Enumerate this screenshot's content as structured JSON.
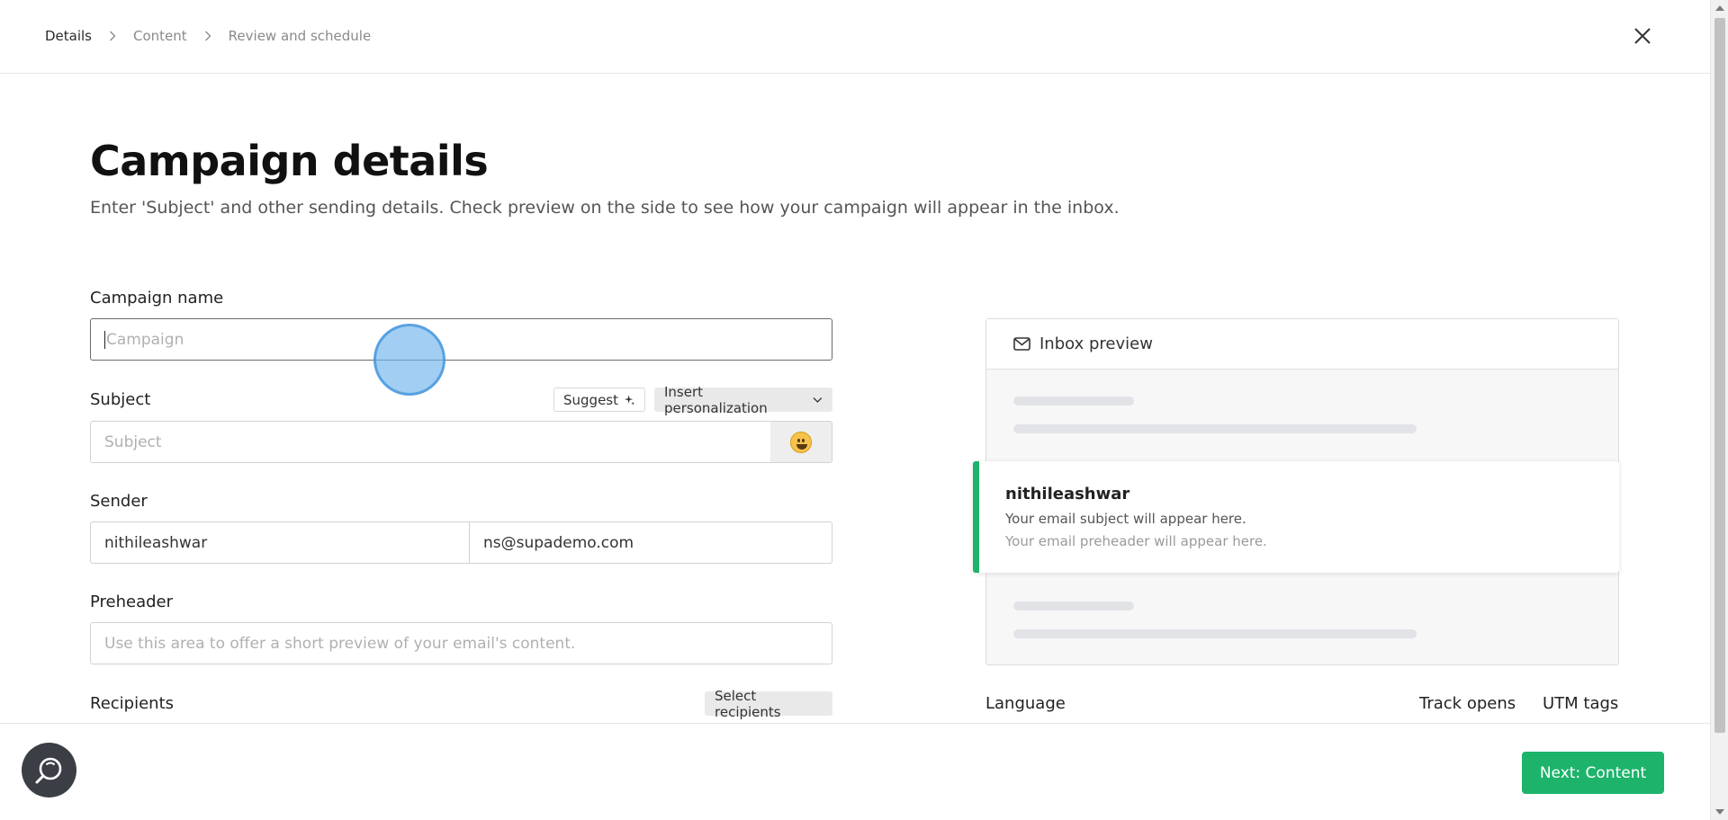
{
  "breadcrumb": {
    "items": [
      {
        "label": "Details",
        "active": true
      },
      {
        "label": "Content",
        "active": false
      },
      {
        "label": "Review and schedule",
        "active": false
      }
    ]
  },
  "header": {
    "title": "Campaign details",
    "subtitle": "Enter 'Subject' and other sending details. Check preview on the side to see how your campaign will appear in the inbox."
  },
  "form": {
    "campaign_name": {
      "label": "Campaign name",
      "placeholder": "Campaign",
      "value": ""
    },
    "subject": {
      "label": "Subject",
      "placeholder": "Subject",
      "value": "",
      "suggest_label": "Suggest",
      "personalization_label": "Insert personalization"
    },
    "sender": {
      "label": "Sender",
      "name": "nithileashwar",
      "email": "ns@supademo.com"
    },
    "preheader": {
      "label": "Preheader",
      "placeholder": "Use this area to offer a short preview of your email's content."
    },
    "recipients": {
      "label": "Recipients",
      "select_label": "Select recipients"
    }
  },
  "preview": {
    "title": "Inbox preview",
    "sender": "nithileashwar",
    "subject_text": "Your email subject will appear here.",
    "preheader_text": "Your email preheader will appear here."
  },
  "settings": {
    "language_label": "Language",
    "track_opens_label": "Track opens",
    "utm_tags_label": "UTM tags"
  },
  "footer": {
    "next_label": "Next: Content"
  },
  "colors": {
    "accent": "#1db36b",
    "help_button": "#3b3f45"
  }
}
